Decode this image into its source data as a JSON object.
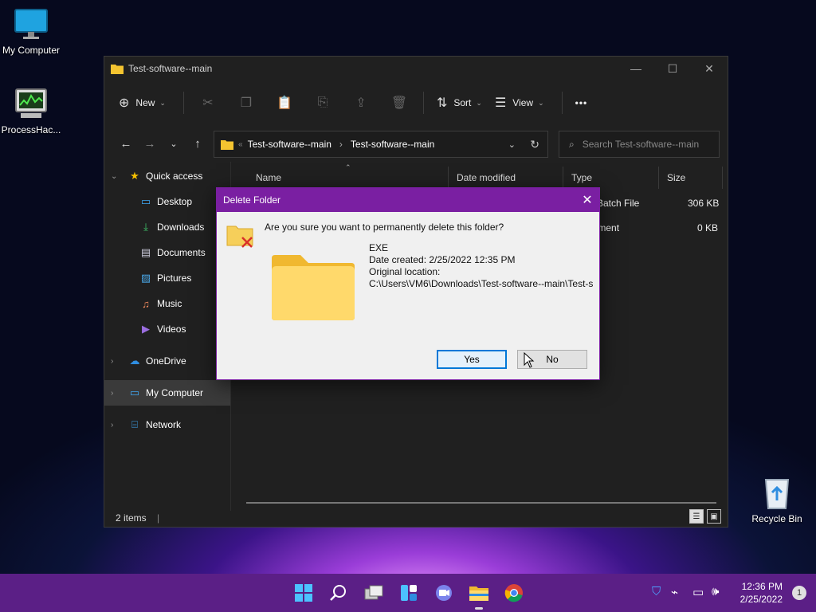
{
  "desktop": {
    "icons": [
      {
        "label": "My Computer"
      },
      {
        "label": "ProcessHac..."
      },
      {
        "label": "Recycle Bin"
      }
    ]
  },
  "explorer": {
    "title": "Test-software--main",
    "toolbar": {
      "new_label": "New",
      "sort_label": "Sort",
      "view_label": "View",
      "more_label": "•••"
    },
    "address": {
      "crumb1": "Test-software--main",
      "crumb2": "Test-software--main",
      "overflow": "«"
    },
    "search": {
      "placeholder": "Search Test-software--main"
    },
    "nav": {
      "quick_access": "Quick access",
      "desktop": "Desktop",
      "downloads": "Downloads",
      "documents": "Documents",
      "pictures": "Pictures",
      "music": "Music",
      "videos": "Videos",
      "onedrive": "OneDrive",
      "my_computer": "My Computer",
      "network": "Network"
    },
    "columns": {
      "name": "Name",
      "date": "Date modified",
      "type": "Type",
      "size": "Size"
    },
    "files": [
      {
        "type": "ws Batch File",
        "size": "306 KB"
      },
      {
        "type": "ocument",
        "size": "0 KB"
      }
    ],
    "status": "2 items"
  },
  "dialog": {
    "title": "Delete Folder",
    "question": "Are you sure you want to permanently delete this folder?",
    "folder_name": "EXE",
    "date_created": "Date created: 2/25/2022 12:35 PM",
    "original_location_label": "Original location:",
    "original_location": "C:\\Users\\VM6\\Downloads\\Test-software--main\\Test-s",
    "yes_label": "Yes",
    "no_label": "No"
  },
  "taskbar": {
    "time": "12:36 PM",
    "date": "2/25/2022",
    "notification_count": "1",
    "accent": "#5b1f86"
  }
}
